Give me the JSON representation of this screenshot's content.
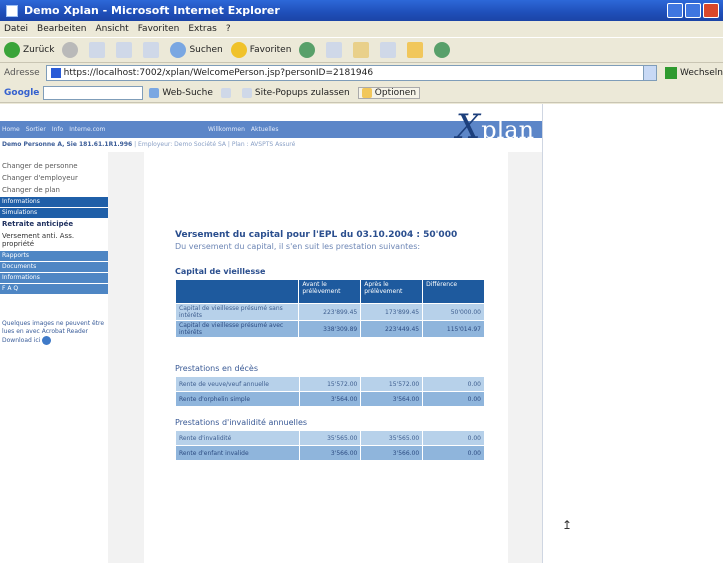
{
  "window": {
    "title": "Demo Xplan - Microsoft Internet Explorer"
  },
  "menubar": {
    "items": [
      "Datei",
      "Bearbeiten",
      "Ansicht",
      "Favoriten",
      "Extras",
      "?"
    ]
  },
  "toolbar": {
    "back_label": "Zurück",
    "search_label": "Suchen",
    "favorites_label": "Favoriten"
  },
  "addressbar": {
    "label": "Adresse",
    "url": "https://localhost:7002/xplan/WelcomePerson.jsp?personID=2181946",
    "go_label": "Wechseln"
  },
  "googlebar": {
    "logo": "Google",
    "web_search": "Web-Suche",
    "popup_label": "Site-Popups zulassen",
    "options_label": "Optionen"
  },
  "app": {
    "logo_letter": "X",
    "logo_rest": "plan",
    "nav_links": [
      "Home",
      "Sortier",
      "Info",
      "Interne.com"
    ],
    "nav_links2": [
      "Willkommen",
      "Aktuelles"
    ],
    "person_name": "Demo Personne A, Sie 181.61.1R1.996",
    "person_detail": "| Employeur: Demo Société SA | Plan : AVSPTS Assuré"
  },
  "sidebar": {
    "links": [
      "Changer de personne",
      "Changer d'employeur",
      "Changer de plan"
    ],
    "head_info": "Informations",
    "head_simulations": "Simulations",
    "sub_items": [
      "Retraite anticipée",
      "Versement anti. Ass. propriété"
    ],
    "heads_after": [
      "Rapports",
      "Documents",
      "Informations",
      "F A Q"
    ],
    "note": "Quelques images ne peuvent être lues en avec Acrobat Reader",
    "download": "Download ici"
  },
  "main": {
    "title": "Versement du capital pour l'EPL du 03.10.2004 : 50'000",
    "subtitle": "Du versement du capital, il s'en suit les prestation suivantes:",
    "capital_section": "Capital de vieillesse",
    "capital_headers": [
      "",
      "Avant le prélèvement",
      "Après le prélèvement",
      "Différence"
    ],
    "capital_rows": [
      [
        "Capital de vieillesse présumé sans intérêts",
        "223'899.45",
        "173'899.45",
        "50'000.00"
      ],
      [
        "Capital de vieillesse présumé avec intérêts",
        "338'309.89",
        "223'449.45",
        "115'014.97"
      ]
    ],
    "deces_section": "Prestations en décès",
    "deces_rows": [
      [
        "Rente de veuve/veuf annuelle",
        "15'572.00",
        "15'572.00",
        "0.00"
      ],
      [
        "Rente d'orphelin simple",
        "3'564.00",
        "3'564.00",
        "0.00"
      ]
    ],
    "invalid_section": "Prestations d'invalidité annuelles",
    "invalid_rows": [
      [
        "Rente d'invalidité",
        "35'565.00",
        "35'565.00",
        "0.00"
      ],
      [
        "Rente d'enfant invalide",
        "3'566.00",
        "3'566.00",
        "0.00"
      ]
    ]
  }
}
